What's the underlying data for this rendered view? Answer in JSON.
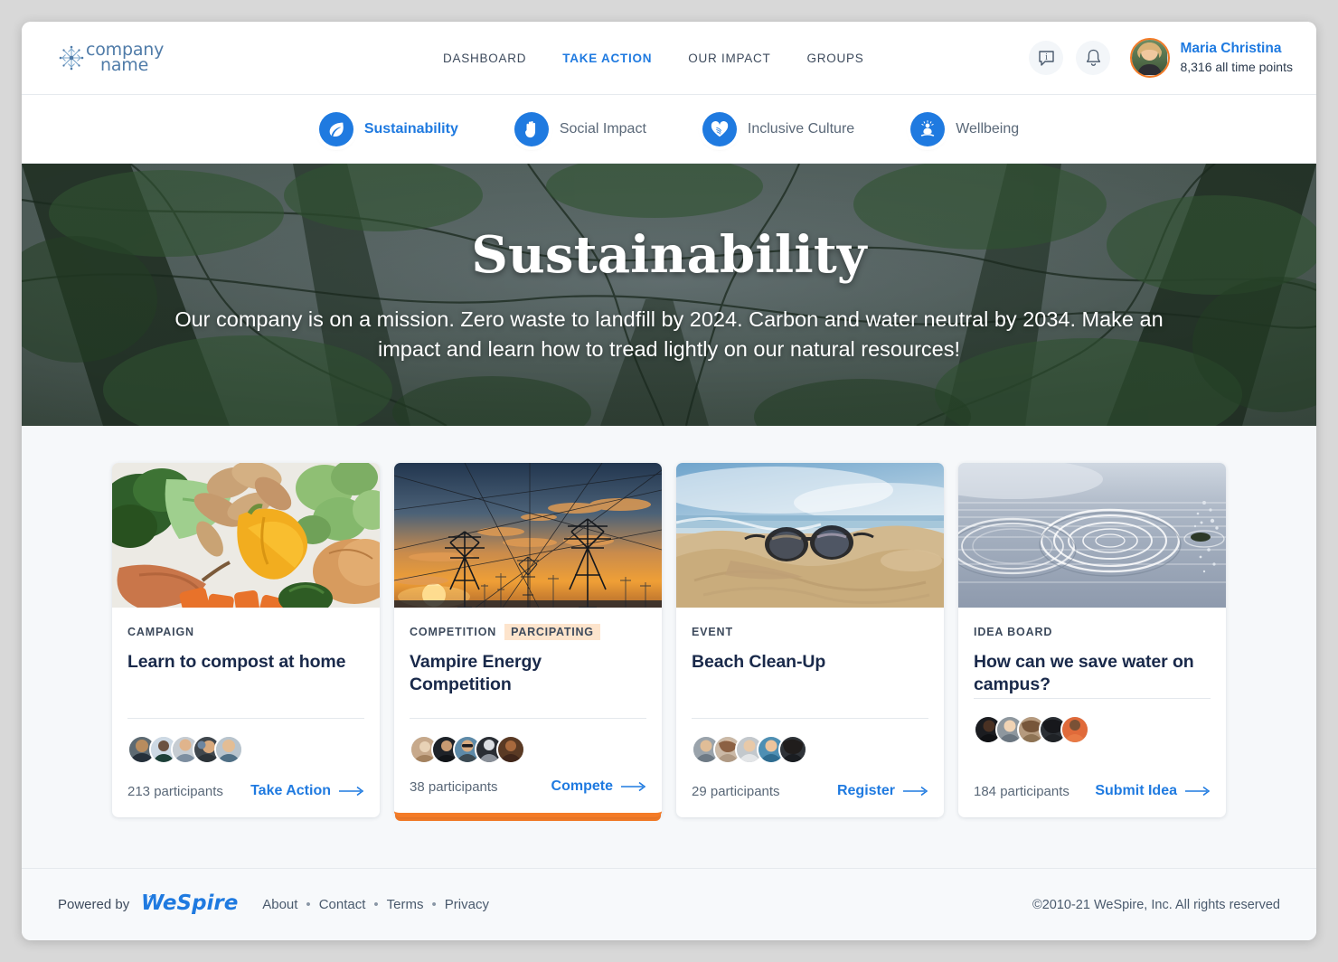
{
  "brand": {
    "line1": "company",
    "line2": "name",
    "icon": "snowflake-logo-icon"
  },
  "nav": [
    {
      "label": "DASHBOARD",
      "active": false
    },
    {
      "label": "TAKE ACTION",
      "active": true
    },
    {
      "label": "OUR IMPACT",
      "active": false
    },
    {
      "label": "GROUPS",
      "active": false
    }
  ],
  "header_icons": [
    {
      "name": "info-message-icon",
      "glyph": "i"
    },
    {
      "name": "notification-bell-icon",
      "glyph": "bell"
    }
  ],
  "user": {
    "name": "Maria Christina",
    "points": "8,316 all time points",
    "avatar_ring_color": "#f47b27"
  },
  "categories": [
    {
      "label": "Sustainability",
      "icon": "leaf-icon",
      "active": true
    },
    {
      "label": "Social Impact",
      "icon": "raised-hand-icon",
      "active": false
    },
    {
      "label": "Inclusive Culture",
      "icon": "heart-hands-icon",
      "active": false
    },
    {
      "label": "Wellbeing",
      "icon": "meditation-person-icon",
      "active": false
    }
  ],
  "hero": {
    "title": "Sustainability",
    "subtitle": "Our company is on a mission. Zero waste to landfill by 2024. Carbon and water neutral by 2034. Make an impact and learn how to tread lightly on our natural resources!",
    "image": "forest-canopy-looking-up"
  },
  "cards": [
    {
      "type": "CAMPAIGN",
      "badge": null,
      "title": "Learn to compost at home",
      "participants": "213 participants",
      "cta": "Take Action",
      "image": "vegetables-broccoli-potatoes-pepper",
      "participating": false
    },
    {
      "type": "COMPETITION",
      "badge": "PARCIPATING",
      "title": "Vampire Energy Competition",
      "participants": "38 participants",
      "cta": "Compete",
      "image": "power-lines-at-sunset",
      "participating": true
    },
    {
      "type": "EVENT",
      "badge": null,
      "title": "Beach Clean-Up",
      "participants": "29 participants",
      "cta": "Register",
      "image": "sunglasses-on-beach-sand",
      "participating": false
    },
    {
      "type": "IDEA BOARD",
      "badge": null,
      "title": "How can we save water on campus?",
      "participants": "184 participants",
      "cta": "Submit Idea",
      "image": "water-ripples-droplet",
      "participating": false
    }
  ],
  "footer": {
    "powered_by": "Powered by",
    "logo_text": "WeSpire",
    "links": [
      "About",
      "Contact",
      "Terms",
      "Privacy"
    ],
    "separator": "•",
    "copyright": "©2010-21 WeSpire, Inc. All rights reserved"
  },
  "colors": {
    "accent_blue": "#1f7ae0",
    "accent_orange": "#f47b27",
    "badge_bg": "#fde4cc",
    "page_bg": "#f6f8fa",
    "title_navy": "#19294a"
  }
}
